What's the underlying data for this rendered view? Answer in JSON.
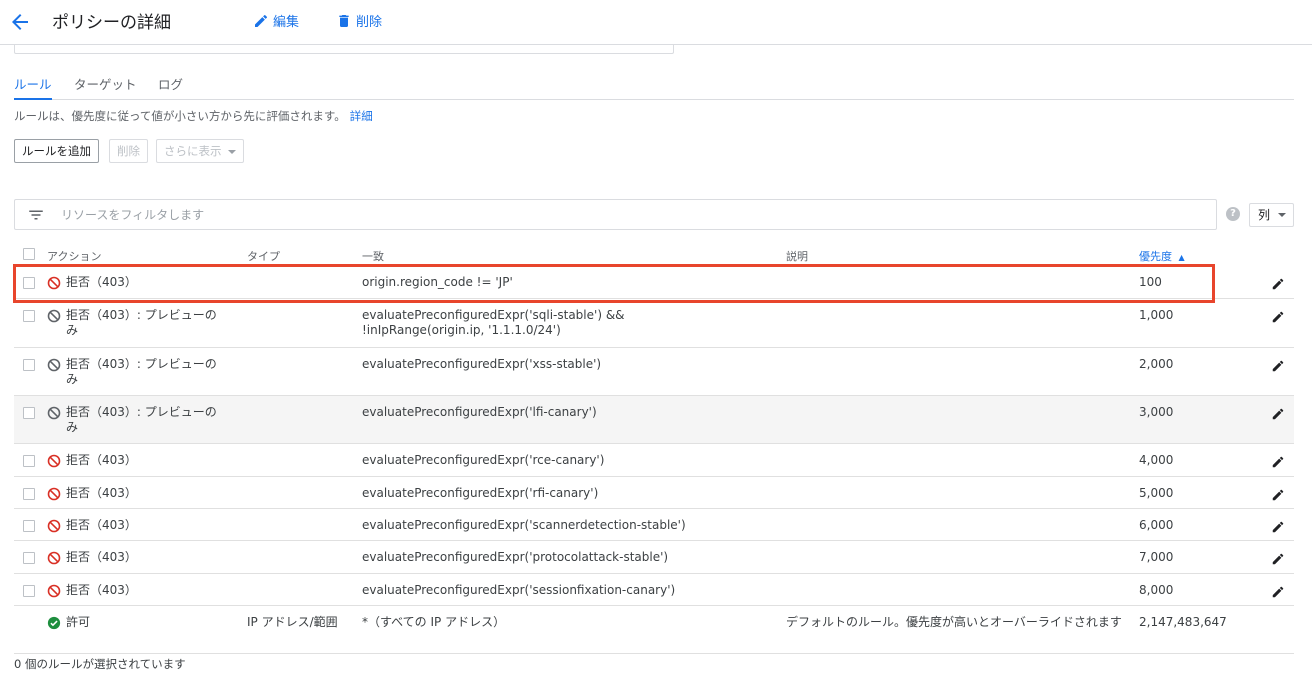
{
  "header": {
    "title": "ポリシーの詳細",
    "edit_label": "編集",
    "delete_label": "削除"
  },
  "tabs": [
    {
      "label": "ルール",
      "active": true
    },
    {
      "label": "ターゲット",
      "active": false
    },
    {
      "label": "ログ",
      "active": false
    }
  ],
  "description": {
    "text": "ルールは、優先度に従って値が小さい方から先に評価されます。",
    "link": "詳細"
  },
  "toolbar": {
    "add_rule": "ルールを追加",
    "delete": "削除",
    "more": "さらに表示"
  },
  "filter": {
    "placeholder": "リソースをフィルタします",
    "help": "?",
    "columns_label": "列"
  },
  "table": {
    "headers": {
      "action": "アクション",
      "type": "タイプ",
      "match": "一致",
      "description": "説明",
      "priority": "優先度",
      "sort_indicator": "▲"
    },
    "rows": [
      {
        "icon": "deny-icon",
        "action": "拒否（403）",
        "type": "",
        "match": "origin.region_code != 'JP'",
        "description": "",
        "priority": "100",
        "checkbox": true
      },
      {
        "icon": "deny-preview-icon",
        "action": "拒否（403）: プレビューのみ",
        "type": "",
        "match": "evaluatePreconfiguredExpr('sqli-stable') && !inIpRange(origin.ip, '1.1.1.0/24')",
        "description": "",
        "priority": "1,000",
        "checkbox": true
      },
      {
        "icon": "deny-preview-icon",
        "action": "拒否（403）: プレビューのみ",
        "type": "",
        "match": "evaluatePreconfiguredExpr('xss-stable')",
        "description": "",
        "priority": "2,000",
        "checkbox": true
      },
      {
        "icon": "deny-preview-icon",
        "action": "拒否（403）: プレビューのみ",
        "type": "",
        "match": "evaluatePreconfiguredExpr('lfi-canary')",
        "description": "",
        "priority": "3,000",
        "checkbox": true
      },
      {
        "icon": "deny-icon",
        "action": "拒否（403）",
        "type": "",
        "match": "evaluatePreconfiguredExpr('rce-canary')",
        "description": "",
        "priority": "4,000",
        "checkbox": true
      },
      {
        "icon": "deny-icon",
        "action": "拒否（403）",
        "type": "",
        "match": "evaluatePreconfiguredExpr('rfi-canary')",
        "description": "",
        "priority": "5,000",
        "checkbox": true
      },
      {
        "icon": "deny-icon",
        "action": "拒否（403）",
        "type": "",
        "match": "evaluatePreconfiguredExpr('scannerdetection-stable')",
        "description": "",
        "priority": "6,000",
        "checkbox": true
      },
      {
        "icon": "deny-icon",
        "action": "拒否（403）",
        "type": "",
        "match": "evaluatePreconfiguredExpr('protocolattack-stable')",
        "description": "",
        "priority": "7,000",
        "checkbox": true
      },
      {
        "icon": "deny-icon",
        "action": "拒否（403）",
        "type": "",
        "match": "evaluatePreconfiguredExpr('sessionfixation-canary')",
        "description": "",
        "priority": "8,000",
        "checkbox": true
      },
      {
        "icon": "allow-icon",
        "action": "許可",
        "type": "IP アドレス/範囲",
        "match": "*（すべての IP アドレス）",
        "description": "デフォルトのルール。優先度が高いとオーバーライドされます",
        "priority": "2,147,483,647",
        "checkbox": false
      }
    ]
  },
  "status": "0 個のルールが選択されています",
  "colors": {
    "accent": "#1a73e8",
    "deny": "#d93025",
    "preview": "#5f6368",
    "allow": "#1e8e3e",
    "highlight": "#e8452c"
  }
}
